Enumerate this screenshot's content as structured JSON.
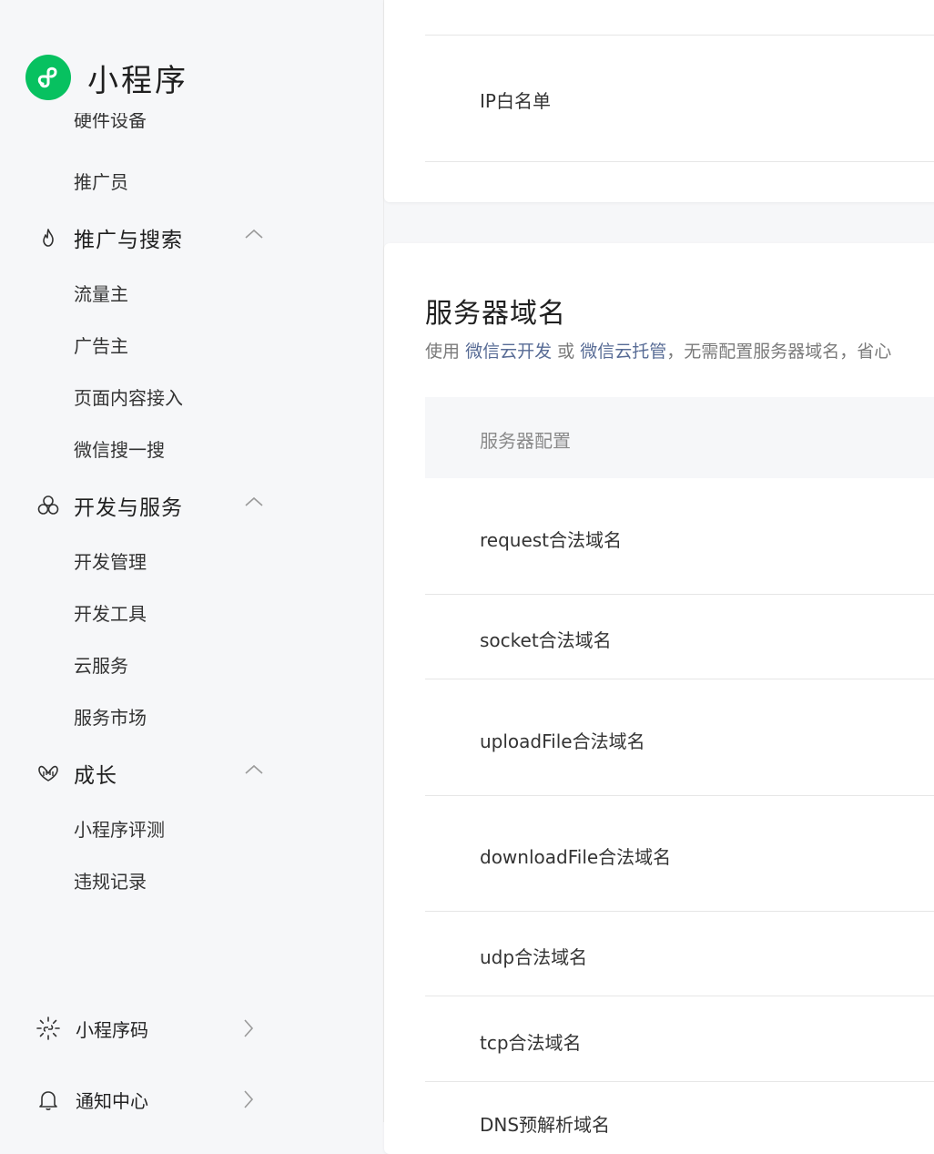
{
  "sidebar": {
    "logo_text": "小程序",
    "items_top": [
      "硬件设备",
      "推广员"
    ],
    "groups": [
      {
        "label": "推广与搜索",
        "icon": "flame-icon",
        "items": [
          "流量主",
          "广告主",
          "页面内容接入",
          "微信搜一搜"
        ]
      },
      {
        "label": "开发与服务",
        "icon": "hexagons-icon",
        "items": [
          "开发管理",
          "开发工具",
          "云服务",
          "服务市场"
        ]
      },
      {
        "label": "成长",
        "icon": "growth-hands-icon",
        "items": [
          "小程序评测",
          "违规记录"
        ]
      }
    ],
    "bottom": [
      {
        "label": "小程序码",
        "icon": "qrcode-sun-icon"
      },
      {
        "label": "通知中心",
        "icon": "bell-icon"
      }
    ]
  },
  "ip_card": {
    "row_label": "IP白名单"
  },
  "server_card": {
    "title": "服务器域名",
    "desc_prefix": "使用",
    "link1": "微信云开发",
    "desc_or": "或",
    "link2": "微信云托管",
    "desc_suffix": "，无需配置服务器域名，省心",
    "table_header": "服务器配置",
    "rows": [
      "request合法域名",
      "socket合法域名",
      "uploadFile合法域名",
      "downloadFile合法域名",
      "udp合法域名",
      "tcp合法域名",
      "DNS预解析域名"
    ]
  },
  "colors": {
    "brand": "#07c160",
    "link": "#576b95"
  }
}
